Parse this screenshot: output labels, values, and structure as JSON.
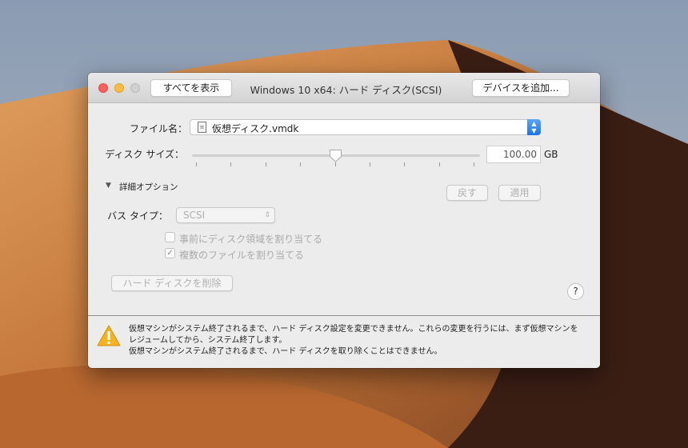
{
  "window": {
    "title": "Windows 10 x64: ハード ディスク(SCSI)",
    "show_all": "すべてを表示",
    "add_device": "デバイスを追加..."
  },
  "file": {
    "label": "ファイル名：",
    "value": "仮想ディスク.vmdk"
  },
  "disk_size": {
    "label": "ディスク サイズ：",
    "value": "100.00",
    "unit": "GB",
    "slider_fraction": 0.5
  },
  "advanced": {
    "label": "詳細オプション",
    "revert": "戻す",
    "apply": "適用"
  },
  "bus": {
    "label": "バス タイプ：",
    "value": "SCSI"
  },
  "options": [
    {
      "label": "事前にディスク領域を割り当てる",
      "checked": false
    },
    {
      "label": "複数のファイルを割り当てる",
      "checked": true
    }
  ],
  "remove": "ハード ディスクを削除",
  "help": "?",
  "warning": {
    "line1": "仮想マシンがシステム終了されるまで、ハード ディスク設定を変更できません。これらの変更を行うには、まず仮想マシンを",
    "line2": "レジュームしてから、システム終了します。",
    "line3": "仮想マシンがシステム終了されるまで、ハード ディスクを取り除くことはできません。"
  }
}
